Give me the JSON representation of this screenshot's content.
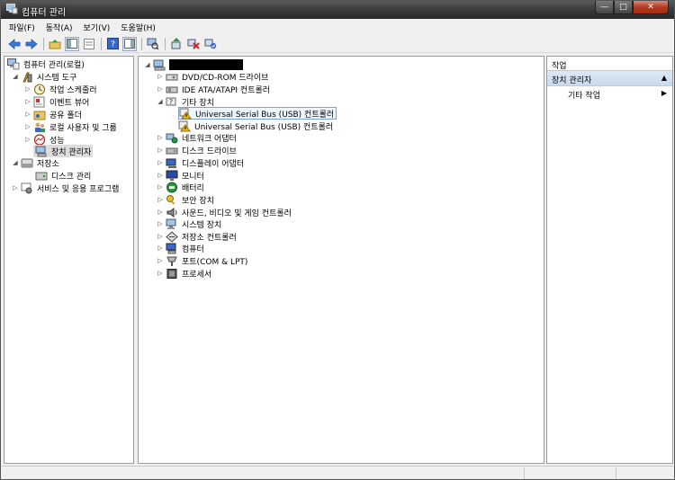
{
  "window": {
    "title": "컴퓨터 관리",
    "buttons": {
      "minimize": "—",
      "maximize": "□",
      "close": "✕"
    }
  },
  "menubar": [
    "파일(F)",
    "동작(A)",
    "보기(V)",
    "도움말(H)"
  ],
  "left_tree": {
    "root": "컴퓨터 관리(로컬)",
    "system_tools": "시스템 도구",
    "task_scheduler": "작업 스케줄러",
    "event_viewer": "이벤트 뷰어",
    "shared_folders": "공유 폴더",
    "local_users": "로컬 사용자 및 그룹",
    "performance": "성능",
    "device_manager": "장치 관리자",
    "storage": "저장소",
    "disk_management": "디스크 관리",
    "services_apps": "서비스 및 응용 프로그램"
  },
  "device_tree": {
    "dvd": "DVD/CD-ROM 드라이브",
    "ide": "IDE ATA/ATAPI 컨트롤러",
    "other": "기타 장치",
    "usb1": "Universal Serial Bus (USB) 컨트롤러",
    "usb2": "Universal Serial Bus (USB) 컨트롤러",
    "network": "네트워크 어댑터",
    "disk": "디스크 드라이브",
    "display": "디스플레이 어댑터",
    "monitor": "모니터",
    "battery": "배터리",
    "security": "보안 장치",
    "sound": "사운드, 비디오 및 게임 컨트롤러",
    "system": "시스템 장치",
    "storage_ctrl": "저장소 컨트롤러",
    "computer": "컴퓨터",
    "ports": "포트(COM & LPT)",
    "processor": "프로세서"
  },
  "actions": {
    "header": "작업",
    "group": "장치 관리자",
    "item": "기타 작업"
  }
}
